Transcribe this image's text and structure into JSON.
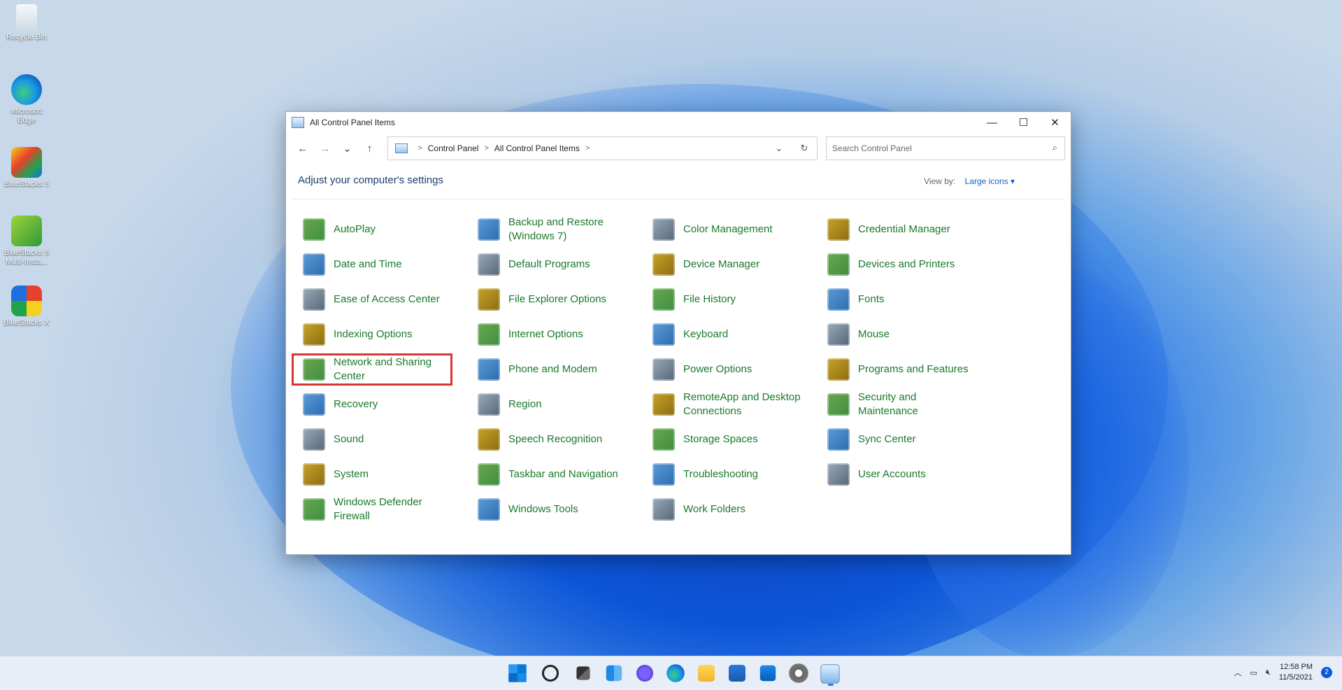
{
  "desktop": {
    "icons": [
      {
        "label": "Recycle Bin"
      },
      {
        "label": "Microsoft Edge"
      },
      {
        "label": "BlueStacks 5"
      },
      {
        "label": "BlueStacks 5 Multi-Insta..."
      },
      {
        "label": "BlueStacks X"
      }
    ]
  },
  "window": {
    "title": "All Control Panel Items",
    "controls": {
      "minimize": "—",
      "maximize": "☐",
      "close": "✕"
    },
    "nav": {
      "back": "←",
      "forward": "→",
      "recent": "⌄",
      "up": "↑"
    },
    "breadcrumb": [
      "Control Panel",
      "All Control Panel Items"
    ],
    "search_placeholder": "Search Control Panel",
    "heading": "Adjust your computer's settings",
    "view_by_label": "View by:",
    "view_by_value": "Large icons ▾"
  },
  "items": [
    [
      "AutoPlay",
      "Backup and Restore (Windows 7)",
      "Color Management",
      "Credential Manager"
    ],
    [
      "Date and Time",
      "Default Programs",
      "Device Manager",
      "Devices and Printers"
    ],
    [
      "Ease of Access Center",
      "File Explorer Options",
      "File History",
      "Fonts"
    ],
    [
      "Indexing Options",
      "Internet Options",
      "Keyboard",
      "Mouse"
    ],
    [
      "Network and Sharing Center",
      "Phone and Modem",
      "Power Options",
      "Programs and Features"
    ],
    [
      "Recovery",
      "Region",
      "RemoteApp and Desktop Connections",
      "Security and Maintenance"
    ],
    [
      "Sound",
      "Speech Recognition",
      "Storage Spaces",
      "Sync Center"
    ],
    [
      "System",
      "Taskbar and Navigation",
      "Troubleshooting",
      "User Accounts"
    ],
    [
      "Windows Defender Firewall",
      "Windows Tools",
      "Work Folders",
      ""
    ]
  ],
  "highlighted_item": "Network and Sharing Center",
  "taskbar": {
    "time": "12:58 PM",
    "date": "11/5/2021",
    "notification_count": "2"
  }
}
